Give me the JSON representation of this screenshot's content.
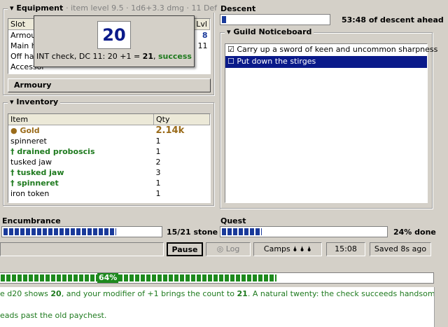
{
  "equipment": {
    "title": "Equipment",
    "subtitle": "· item level 9.5 · 1d6+3.3 dmg · 11 Def",
    "columns": {
      "slot": "Slot",
      "lvl": "Lvl"
    },
    "rows": [
      {
        "slot": "Armour",
        "lvl": "8"
      },
      {
        "slot": "Main h",
        "lvl": "11"
      },
      {
        "slot": "Off har",
        "lvl": ""
      },
      {
        "slot": "Accessor",
        "lvl": ""
      }
    ],
    "armoury_button": "Armoury"
  },
  "dice_popup": {
    "roll": "20",
    "text_prefix": "INT check, DC 11: 20 +1 = ",
    "total": "21",
    "separator": ", ",
    "result": "success"
  },
  "descent": {
    "title": "Descent",
    "text": "53:48 of descent ahead",
    "progress": 0.05
  },
  "noticeboard": {
    "title": "Guild Noticeboard",
    "items": [
      {
        "mark": "☑",
        "text": "Carry up a sword of keen and uncommon sharpness",
        "selected": false
      },
      {
        "mark": "☐",
        "text": "Put down the stirges",
        "selected": true
      }
    ]
  },
  "inventory": {
    "title": "Inventory",
    "columns": {
      "item": "Item",
      "qty": "Qty"
    },
    "rows": [
      {
        "prefix": "●",
        "name": "Gold",
        "qty": "2.14k",
        "style": "gold"
      },
      {
        "prefix": "",
        "name": "spinneret",
        "qty": "1",
        "style": "plain"
      },
      {
        "prefix": "†",
        "name": "drained proboscis",
        "qty": "1",
        "style": "green"
      },
      {
        "prefix": "",
        "name": "tusked jaw",
        "qty": "2",
        "style": "plain"
      },
      {
        "prefix": "†",
        "name": "tusked jaw",
        "qty": "3",
        "style": "green"
      },
      {
        "prefix": "†",
        "name": "spinneret",
        "qty": "1",
        "style": "green"
      },
      {
        "prefix": "",
        "name": "iron token",
        "qty": "1",
        "style": "plain"
      }
    ]
  },
  "encumbrance": {
    "title": "Encumbrance",
    "text": "15/21 stone",
    "fraction": 0.714
  },
  "quest": {
    "title": "Quest",
    "text": "24% done",
    "fraction": 0.24
  },
  "statusbar": {
    "pause": "Pause",
    "log": "Log",
    "camps_label": "Camps",
    "camps_icons": "🌢 🌢 🌢",
    "time": "15:08",
    "saved": "Saved 8s ago"
  },
  "xp": {
    "label": "64%",
    "fraction": 0.64
  },
  "log": {
    "line1_a": "e d20 shows ",
    "line1_b": "20",
    "line1_c": ", and your modifier of +1 brings the count to ",
    "line1_d": "21",
    "line1_e": ". A natural twenty: the check succeeds handsomely!",
    "line2": "eads past the old paychest."
  },
  "colors": {
    "accent_blue": "#1a3a9a",
    "success_green": "#1e7a1e",
    "selection": "#0a1a8a",
    "gold": "#9a6b1a"
  }
}
